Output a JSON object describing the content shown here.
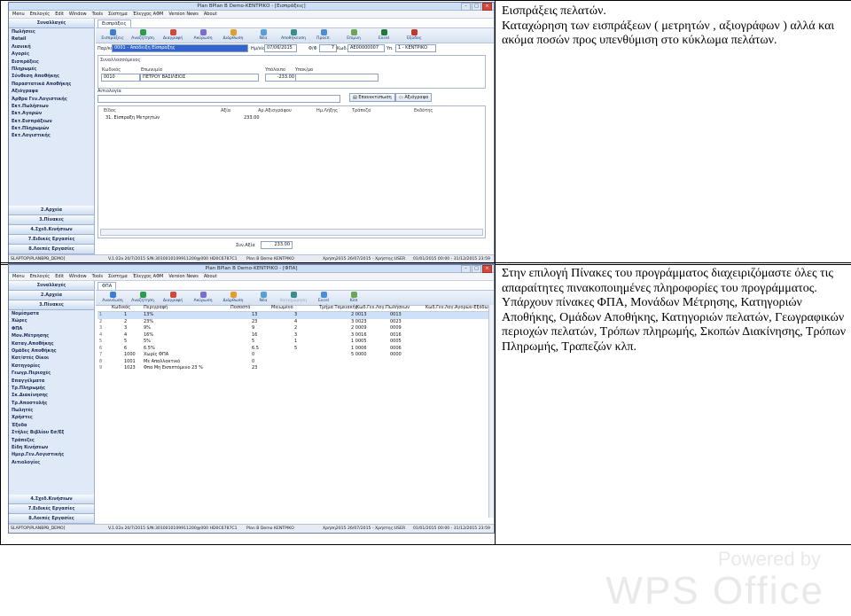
{
  "rows": [
    {
      "paragraphs": [
        "Εισπράξεις πελατών.",
        "Καταχώρηση των εισπράξεων ( μετρητών , αξιογράφων ) αλλά και ακόμα ποσών προς υπενθύμιση στο κύκλωμα πελάτων."
      ]
    },
    {
      "paragraphs": [
        "Στην επιλογή Πίνακες του προγράμματος διαχειριζόμαστε όλες τις απαραίτητες πινακοποιημένες πληροφορίες του προγράμματος.",
        "Υπάρχουν πίνακες ΦΠΑ, Μονάδων Μέτρησης, Κατηγοριών Αποθήκης, Ομάδων Αποθήκης, Κατηγοριών πελατών, Γεωγραφικών περιοχών πελατών, Τρόπων πληρωμής, Σκοπών Διακίνησης, Τρόπων Πληρωμής, Τραπεζών κλπ."
      ]
    }
  ],
  "win1": {
    "title": "Plan BPlan B Demo-ΚΕΝΤΡΙΚΟ - [Εισπράξεις]",
    "menu": [
      "Menu",
      "Επιλογές",
      "Edit",
      "Window",
      "Tools",
      "Σύστημα",
      "Έλεγχος ΑΦΜ",
      "Version News",
      "About"
    ],
    "sidebar_title": "Συναλλαγές",
    "sidebar_items": [
      "Πωλήσεις",
      "Retail",
      "Λιανική",
      "Αγορές",
      "Εισπράξεις",
      "Πληρωμές",
      "Σύνθεση Αποθήκης",
      "Παραστατικά Αποθήκης",
      "Αξιόγραφα",
      "Άρθρα Γεν.Λογιστικής",
      "Εκτ.Πωλήσεων",
      "Εκτ.Αγορών",
      "Εκτ.Εισπράξεων",
      "Εκτ.Πληρωμών",
      "Εκτ.Λογιστικής"
    ],
    "sidebar_bottom": [
      "2.Αρχεία",
      "3.Πίνακες",
      "4.Σχεδ.Κινήσεων",
      "7.Ειδικές Εργασίες",
      "8.Λοιπές Εργασίες"
    ],
    "tab": "Εισπράξεις",
    "toolbar": [
      "Εισπράξεις",
      "Αναζήτηση",
      "Διαγραφή",
      "Ακύρωση",
      "Διόρθωση",
      "Νέα",
      "Αποθήκευση",
      "Προεπ.",
      "Επιμνη",
      "Excel",
      "Έξοδος"
    ],
    "doc": {
      "type_label": "Παρ/κό",
      "type_value": "0001 - Απόδειξη Είσπραξης",
      "date_label": "Ημ/νία",
      "date_value": "07/06/2015",
      "series_label": "Φ/Φ",
      "series_value": "7",
      "code_label": "Κωδ.",
      "code_value": "ΑΕ00000007",
      "branch_label": "Υπ.",
      "branch_value": "1 - ΚΕΝΤΡΙΚΟ"
    },
    "party": {
      "group": "Συναλλασσόμενος",
      "h_code": "Κωδικός",
      "h_name": "Επωνυμία",
      "h_balance": "Υπόλοιπο",
      "h_branch": "Υποκ/μα",
      "code": "0010",
      "name": "ΠΕΤΡΟΥ ΒΑΣΙΛΕΙΟΣ",
      "balance": "-233.00"
    },
    "reason_label": "Αιτιολογία",
    "btn_check": "Επανεκτύπωση",
    "btn_notes": "Αξιόγραφα",
    "lines_headers": [
      "Είδος",
      "Αξία",
      "Αρ.Αξιογράφου",
      "Ημ.Λήξης",
      "Τράπεζα",
      "Εκδότης"
    ],
    "lines": [
      [
        "31. Είσπραξη Μετρητών",
        "233.00"
      ]
    ],
    "total_label": "Συν.Αξία",
    "total_value": "233.00",
    "status": [
      "SLAPTOP\\PLANBPB_DEMO]",
      "V.1.02a 20/7/2015 S/N:3010010109911200@000 HD0C6787C1",
      "Plan B Demo ΚΕΝΤΡΙΚΟ",
      "Χρήση2015 26/07/2015 - Χρήστης:USER",
      "01/01/2015 00:00 - 31/12/2015 23:59"
    ]
  },
  "win2": {
    "title": "Plan BPlan B Demo-ΚΕΝΤΡΙΚΟ - [ΦΠΑ]",
    "menu": [
      "Menu",
      "Επιλογές",
      "Edit",
      "Window",
      "Tools",
      "Σύστημα",
      "Έλεγχος ΑΦΜ",
      "Version News",
      "About"
    ],
    "sidebar_top": [
      "Συναλλαγές",
      "2.Αρχεία",
      "3.Πίνακες"
    ],
    "sidebar_items": [
      "Νομίσματα",
      "Χώρες",
      "ΦΠΑ",
      "Μον.Μέτρησης",
      "Καταγ.Αποθήκης",
      "Ομάδες Αποθήκης",
      "Κατ/στές Οίκοι",
      "Κατηγορίες",
      "Γεωγρ.Περιοχές",
      "Επαγγέλματα",
      "Τρ.Πληρωμής",
      "Σκ.Διακίνησης",
      "Τρ.Αποστολής",
      "Πωλητές",
      "Χρήστες",
      "Έξοδα",
      "Στήλες Βιβλίου Εσ/Εξ",
      "Τράπεζες",
      "Είδη Κινήσεων",
      "Ημερ.Γεν.Λογιστικής",
      "Αιτιολογίες"
    ],
    "sidebar_bottom": [
      "4.Σχεδ.Κινήσεων",
      "7.Ειδικές Εργασίες",
      "8.Λοιπές Εργασίες"
    ],
    "tab": "ΦΠΑ",
    "toolbar": [
      "Ανανέωση",
      "Αναζήτηση",
      "Διαγραφή",
      "Ακύρωση",
      "Διόρθωση",
      "Νέα",
      "Καταχώρηση",
      "Excel",
      "Κλπ"
    ],
    "headers": [
      "Κωδικός",
      "Περιγραφή",
      "Ποσοστό",
      "Μειωμένο",
      "Τμήμα Ταμειακής",
      "Κωδ.Γεν.Λογ.Πωλήσεων",
      "Κωδ.Γεν.Λογ.Αγορών-Εξόδων"
    ],
    "rows": [
      [
        "1",
        "1",
        "13%",
        "13",
        "3",
        "2 0013",
        "0013"
      ],
      [
        "2",
        "2",
        "23%",
        "23",
        "4",
        "3 0023",
        "0023"
      ],
      [
        "3",
        "3",
        "9%",
        "9",
        "2",
        "2 0009",
        "0009"
      ],
      [
        "4",
        "4",
        "16%",
        "16",
        "3",
        "3 0016",
        "0016"
      ],
      [
        "5",
        "5",
        "5%",
        "5",
        "1",
        "1 0005",
        "0005"
      ],
      [
        "6",
        "6",
        "6.5%",
        "6.5",
        "5",
        "1 0006",
        "0006"
      ],
      [
        "7",
        "1000",
        "Χωρίς ΦΠΑ",
        "0",
        "",
        "5 0000",
        "0000"
      ],
      [
        "8",
        "1001",
        "Με Απαλλακτικό",
        "0",
        "",
        "",
        ""
      ],
      [
        "9",
        "1023",
        "Φπα Μη Εκπιπτόμενο 23 %",
        "23",
        "",
        "",
        ""
      ]
    ],
    "status": [
      "SLAPTOP\\PLANBPB_DEMO]",
      "V.1.02a 20/7/2015 S/N:3010010109911200@000 HD0C6787C1",
      "Plan B Demo ΚΕΝΤΡΙΚΟ",
      "Χρήση2015 26/07/2015 - Χρήστης:USER",
      "01/01/2015 00:00 - 31/12/2015 23:59"
    ]
  },
  "watermark": {
    "line1": "Powered by",
    "line2": "WPS Office"
  }
}
